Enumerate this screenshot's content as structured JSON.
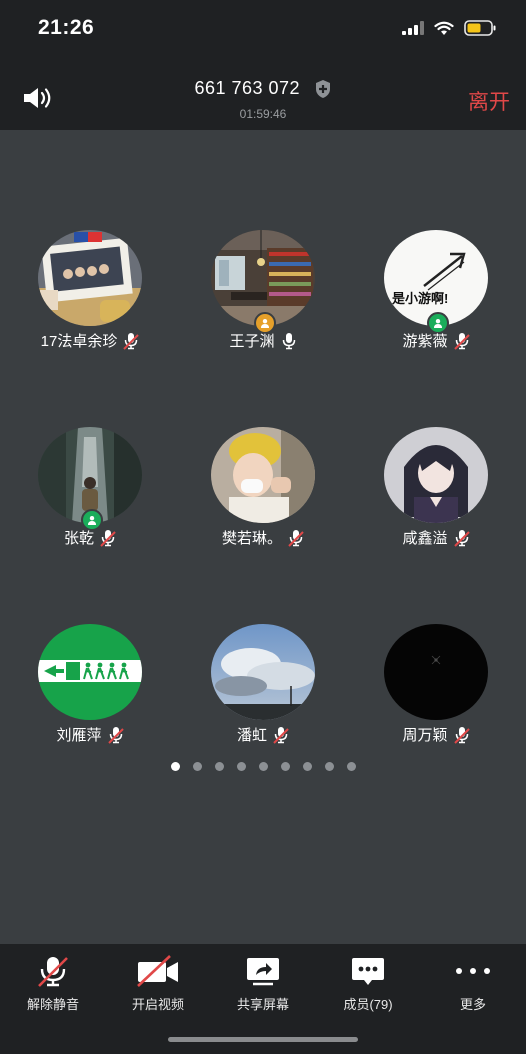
{
  "status": {
    "time": "21:26"
  },
  "header": {
    "meeting_id": "661 763 072",
    "duration": "01:59:46",
    "leave_label": "离开"
  },
  "participants": [
    {
      "name": "17法卓余珍",
      "mic": "muted",
      "badge": null
    },
    {
      "name": "王子渊",
      "mic": "on",
      "badge": "host"
    },
    {
      "name": "游紫薇",
      "mic": "muted",
      "badge": "cohost",
      "avatar_text": "是小游啊!"
    },
    {
      "name": "张乾",
      "mic": "muted",
      "badge": "cohost"
    },
    {
      "name": "樊若琳。",
      "mic": "muted",
      "badge": null
    },
    {
      "name": "咸鑫溢",
      "mic": "muted",
      "badge": null
    },
    {
      "name": "刘雁萍",
      "mic": "muted",
      "badge": null
    },
    {
      "name": "潘虹",
      "mic": "muted",
      "badge": null
    },
    {
      "name": "周万颖",
      "mic": "muted",
      "badge": null
    }
  ],
  "pagination": {
    "pages": 9,
    "current": 1
  },
  "toolbar": {
    "unmute": "解除静音",
    "video": "开启视频",
    "share": "共享屏幕",
    "members": "成员(79)",
    "more": "更多"
  },
  "colors": {
    "leave": "#e04848",
    "host_badge": "#e6a02a",
    "cohost_badge": "#1aad5a",
    "bar_bg": "#1f2123",
    "stage_bg": "#3a3e41"
  }
}
